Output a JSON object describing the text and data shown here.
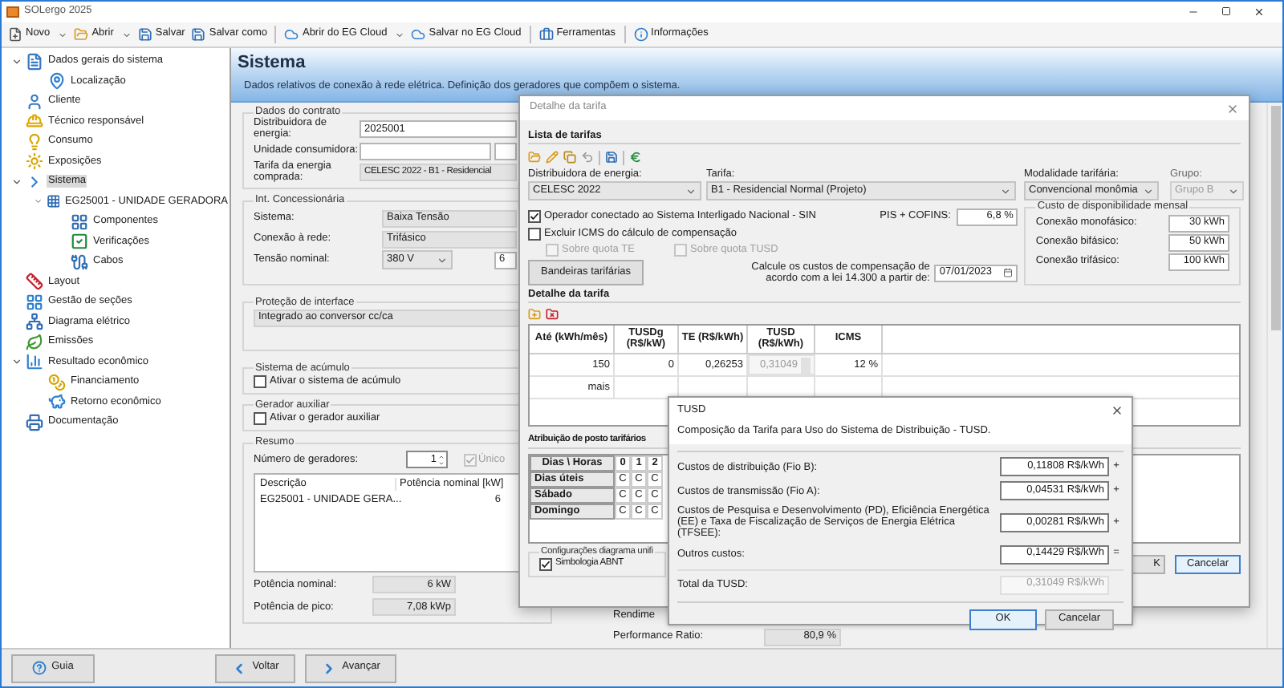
{
  "window": {
    "title": "SOLergo 2025"
  },
  "toolbar": [
    {
      "label": "Novo",
      "kind": "menu",
      "separator_before": false
    },
    {
      "label": "Abrir",
      "kind": "menu",
      "separator_before": false
    },
    {
      "label": "Salvar",
      "kind": "plain",
      "separator_before": false
    },
    {
      "label": "Salvar como",
      "kind": "plain",
      "separator_before": false
    },
    {
      "label": "Abrir do EG Cloud",
      "kind": "menu",
      "separator_before": true
    },
    {
      "label": "Salvar no EG Cloud",
      "kind": "plain",
      "separator_before": false
    },
    {
      "label": "Ferramentas",
      "kind": "plain",
      "separator_before": true
    },
    {
      "label": "Informações",
      "kind": "plain",
      "separator_before": true
    }
  ],
  "sidebar": {
    "items": [
      {
        "label": "Dados gerais do sistema",
        "selected": false,
        "expanded": true,
        "children": [
          {
            "label": "Localização",
            "selected": false
          }
        ]
      },
      {
        "label": "Cliente",
        "selected": false
      },
      {
        "label": "Técnico responsável",
        "selected": false
      },
      {
        "label": "Consumo",
        "selected": false
      },
      {
        "label": "Exposições",
        "selected": false
      },
      {
        "label": "Sistema",
        "selected": true,
        "expanded": true,
        "children": [
          {
            "label": "EG25001 - UNIDADE GERADORA",
            "selected": false,
            "expanded": true,
            "children": [
              {
                "label": "Componentes",
                "selected": false
              },
              {
                "label": "Verificações",
                "selected": false
              },
              {
                "label": "Cabos",
                "selected": false
              }
            ]
          }
        ]
      },
      {
        "label": "Layout",
        "selected": false
      },
      {
        "label": "Gestão de seções",
        "selected": false
      },
      {
        "label": "Diagrama elétrico",
        "selected": false
      },
      {
        "label": "Emissões",
        "selected": false
      },
      {
        "label": "Resultado econômico",
        "selected": false,
        "expanded": true,
        "children": [
          {
            "label": "Financiamento",
            "selected": false
          },
          {
            "label": "Retorno econômico",
            "selected": false
          }
        ]
      },
      {
        "label": "Documentação",
        "selected": false
      }
    ]
  },
  "page_header": {
    "title": "Sistema",
    "description": "Dados relativos de conexão à rede elétrica. Definição dos geradores que compõem o sistema."
  },
  "contract": {
    "legend": "Dados do contrato",
    "distributor_label": "Distribuidora de energia:",
    "distributor": "2025001",
    "unit_label": "Unidade consumidora:",
    "tariff_label": "Tarifa da energia comprada:",
    "tariff": "CELESC 2022 - B1 - Residencial"
  },
  "concessionaria": {
    "legend": "Int. Concessionária",
    "rows": [
      {
        "label": "Sistema:",
        "value": "Baixa Tensão"
      },
      {
        "label": "Conexão à rede:",
        "value": "Trifásico"
      }
    ],
    "voltage_label": "Tensão nominal:",
    "voltage": "380 V",
    "frequency": "6"
  },
  "protection": {
    "legend": "Proteção de interface",
    "value": "Integrado ao conversor  cc/ca"
  },
  "storage": {
    "legend": "Sistema de acúmulo",
    "label": "Ativar o sistema de acúmulo",
    "checked": false
  },
  "aux": {
    "legend": "Gerador auxiliar",
    "label": "Ativar o gerador auxiliar",
    "checked": false
  },
  "summary": {
    "legend": "Resumo",
    "count_label": "Número de geradores:",
    "count": "1",
    "unique": {
      "label": "Único",
      "checked": true
    },
    "columns": [
      "Descrição",
      "Potência nominal [kW]"
    ],
    "rows": [
      [
        "EG25001 - UNIDADE GERA...",
        "6"
      ]
    ],
    "totals": [
      {
        "label": "Potência nominal:",
        "value": "6 kW"
      },
      {
        "label": "Potência de pico:",
        "value": "7,08 kWp"
      }
    ]
  },
  "performance": {
    "partial_label": "Rendime",
    "label": "Performance Ratio:",
    "value": "80,9 %"
  },
  "footer": {
    "help": "Guia",
    "back": "Voltar",
    "next": "Avançar"
  },
  "tariff_dialog": {
    "title": "Detalhe da tarifa",
    "list_section": "Lista de tarifas",
    "selects": [
      {
        "label": "Distribuidora de energia:",
        "value": "CELESC 2022",
        "disabled": false
      },
      {
        "label": "Tarifa:",
        "value": "B1 - Residencial Normal (Projeto)",
        "disabled": false
      },
      {
        "label": "Modalidade tarifária:",
        "value": "Convencional monômia",
        "disabled": false
      },
      {
        "label": "Grupo:",
        "value": "Grupo B",
        "disabled": true
      }
    ],
    "sin": {
      "label": "Operador conectado ao Sistema Interligado Nacional - SIN",
      "checked": true
    },
    "pis": {
      "label": "PIS + COFINS:",
      "value": "6,8 %"
    },
    "icms": {
      "label": "Excluir ICMS do cálculo de compensação",
      "checked": false
    },
    "quotas": [
      {
        "label": "Sobre quota TE",
        "checked": false
      },
      {
        "label": "Sobre quota TUSD",
        "checked": false
      }
    ],
    "flags_button": "Bandeiras tarifárias",
    "law": {
      "label": "Calcule os custos de compensação de acordo com a lei 14.300 a partir de:",
      "value": "07/01/2023"
    },
    "availability": {
      "legend": "Custo de disponibilidade mensal",
      "rows": [
        {
          "label": "Conexão monofásico:",
          "value": "30 kWh"
        },
        {
          "label": "Conexão bifásico:",
          "value": "50 kWh"
        },
        {
          "label": "Conexão trifásico:",
          "value": "100 kWh"
        }
      ]
    },
    "detail_section": "Detalhe da tarifa",
    "detail_table": {
      "columns": [
        "Até (kWh/mês)",
        "TUSDg (R$/kW)",
        "TE (R$/kWh)",
        "TUSD (R$/kWh)",
        "ICMS"
      ],
      "rows": [
        [
          "150",
          "0",
          "0,26253",
          "0,31049",
          "12 %"
        ],
        [
          "mais"
        ]
      ]
    },
    "schedule_section": "Atribuição de posto tarifários",
    "schedule": {
      "header": "Dias \\ Horas",
      "hours": [
        "0",
        "1",
        "2"
      ],
      "rows": [
        {
          "day": "Dias úteis",
          "cells": [
            "C",
            "C",
            "C"
          ]
        },
        {
          "day": "Sábado",
          "cells": [
            "C",
            "C",
            "C"
          ]
        },
        {
          "day": "Domingo",
          "cells": [
            "C",
            "C",
            "C"
          ]
        }
      ]
    },
    "diagram": {
      "legend": "Configurações diagrama unifi",
      "label": "Simbologia ABNT",
      "checked": true
    },
    "buttons": [
      "K",
      "Cancelar"
    ]
  },
  "tusd_dialog": {
    "title": "TUSD",
    "description": "Composição da Tarifa para Uso do Sistema de Distribuição - TUSD.",
    "rows": [
      {
        "kind": "input",
        "label": "Custos de distribuição (Fio B):",
        "value": "0,11808 R$/kWh",
        "operator": "+"
      },
      {
        "kind": "input",
        "label": "Custos de transmissão (Fio A):",
        "value": "0,04531 R$/kWh",
        "operator": "+"
      },
      {
        "kind": "input",
        "label": "Custos de Pesquisa e Desenvolvimento (PD), Eficiência Energética (EE) e Taxa de Fiscalização de Serviços de Energia Elétrica (TFSEE):",
        "value": "0,00281 R$/kWh",
        "operator": "+"
      },
      {
        "kind": "input",
        "label": "Outros custos:",
        "value": "0,14429 R$/kWh",
        "operator": "="
      },
      {
        "kind": "total",
        "label": "Total da TUSD:",
        "value": "0,31049 R$/kWh"
      }
    ],
    "buttons": [
      "OK",
      "Cancelar"
    ]
  }
}
